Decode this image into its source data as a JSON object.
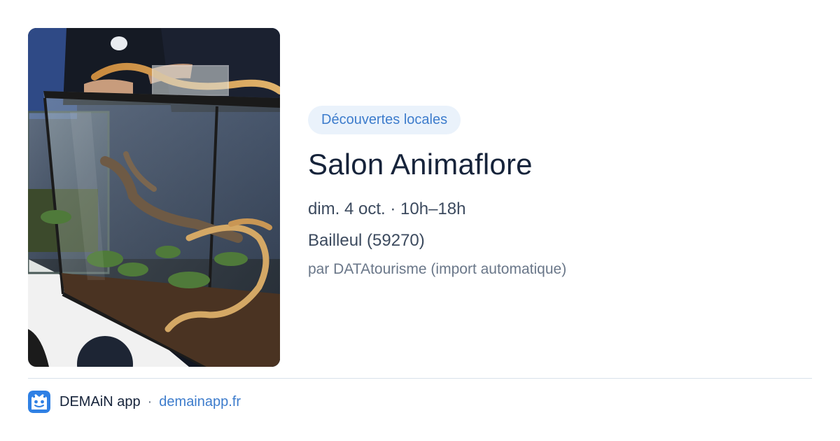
{
  "event": {
    "category": "Découvertes locales",
    "title": "Salon Animaflore",
    "datetime": "dim. 4 oct. · 10h–18h",
    "location": "Bailleul (59270)",
    "source": "par DATAtourisme (import automatique)"
  },
  "photo": {
    "subject": "terrarium with snakes on exhibition table",
    "icon": "event-photo"
  },
  "footer": {
    "app_name": "DEMAiN app",
    "separator": "·",
    "link": "demainapp.fr",
    "icon": "demain-app-logo-icon"
  },
  "colors": {
    "accent": "#3d7ccc",
    "tag_background": "#eaf2fb",
    "title": "#16233a",
    "secondary_text": "#3c4a5e",
    "muted_text": "#6a7789",
    "divider": "#d9e2ea"
  }
}
